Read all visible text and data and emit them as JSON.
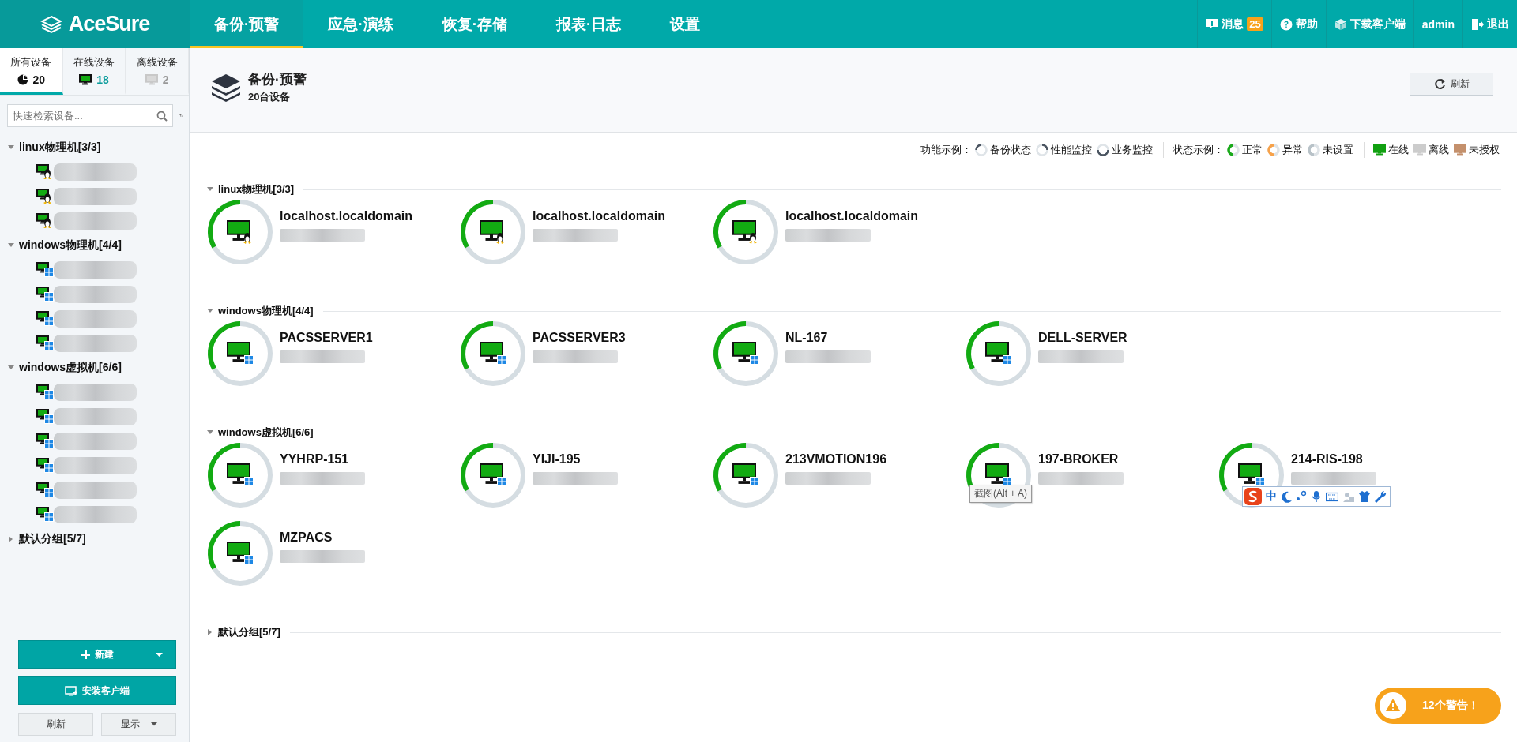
{
  "brand": {
    "name": "AceSure"
  },
  "nav": [
    {
      "label": "备份·预警",
      "selected": true
    },
    {
      "label": "应急·演练",
      "selected": false
    },
    {
      "label": "恢复·存储",
      "selected": false
    },
    {
      "label": "报表·日志",
      "selected": false
    },
    {
      "label": "设置",
      "selected": false
    }
  ],
  "top_links": [
    {
      "kind": "messages",
      "label": "消息",
      "badge": "25"
    },
    {
      "kind": "help",
      "label": "帮助"
    },
    {
      "kind": "download",
      "label": "下载客户端"
    },
    {
      "kind": "user",
      "label": "admin"
    },
    {
      "kind": "logout",
      "label": "退出"
    }
  ],
  "sidebar": {
    "tabs": [
      {
        "kind": "all",
        "label": "所有设备",
        "count": "20",
        "selected": true
      },
      {
        "kind": "online",
        "label": "在线设备",
        "count": "18",
        "selected": false
      },
      {
        "kind": "offline",
        "label": "离线设备",
        "count": "2",
        "selected": false
      }
    ],
    "search": {
      "placeholder": "快速检索设备..."
    },
    "groups": [
      {
        "label": "linux物理机[3/3]",
        "expanded": true,
        "children": [
          {
            "kind": "linux"
          },
          {
            "kind": "linux"
          },
          {
            "kind": "linux"
          }
        ]
      },
      {
        "label": "windows物理机[4/4]",
        "expanded": true,
        "children": [
          {
            "kind": "windows"
          },
          {
            "kind": "windows"
          },
          {
            "kind": "windows"
          },
          {
            "kind": "windows"
          }
        ]
      },
      {
        "label": "windows虚拟机[6/6]",
        "expanded": true,
        "children": [
          {
            "kind": "windows"
          },
          {
            "kind": "windows"
          },
          {
            "kind": "windows"
          },
          {
            "kind": "windows"
          },
          {
            "kind": "windows"
          },
          {
            "kind": "windows"
          }
        ]
      },
      {
        "label": "默认分组[5/7]",
        "expanded": false
      }
    ],
    "new_button": {
      "label": "新建"
    },
    "install_button": {
      "label": "安装客户端"
    },
    "refresh_button": {
      "label": "刷新"
    },
    "display_button": {
      "label": "显示"
    }
  },
  "page_header": {
    "title": "备份·预警",
    "subtitle": "20台设备",
    "refresh_button": "刷新"
  },
  "legend": {
    "function_label": "功能示例：",
    "functions": [
      {
        "kind": "backup",
        "label": "备份状态"
      },
      {
        "kind": "performance",
        "label": "性能监控"
      },
      {
        "kind": "business",
        "label": "业务监控"
      }
    ],
    "status_label": "状态示例：",
    "statuses": [
      {
        "label": "正常",
        "color": "#1aaa1a"
      },
      {
        "label": "异常",
        "color": "#f7a24a"
      },
      {
        "label": "未设置",
        "color": "#b8c2c8"
      }
    ],
    "presence": [
      {
        "label": "在线",
        "color": "#11a011"
      },
      {
        "label": "离线",
        "color": "#cccccc"
      },
      {
        "label": "未授权",
        "color": "#c4906c"
      }
    ]
  },
  "groups": [
    {
      "label": "linux物理机[3/3]",
      "expanded": true,
      "devices": [
        {
          "name": "localhost.localdomain",
          "kind": "linux",
          "color": "#12ab12"
        },
        {
          "name": "localhost.localdomain",
          "kind": "linux",
          "color": "#12ab12"
        },
        {
          "name": "localhost.localdomain",
          "kind": "linux",
          "color": "#12ab12"
        }
      ]
    },
    {
      "label": "windows物理机[4/4]",
      "expanded": true,
      "devices": [
        {
          "name": "PACSSERVER1",
          "kind": "windows",
          "color": "#12ab12"
        },
        {
          "name": "PACSSERVER3",
          "kind": "windows",
          "color": "#12ab12"
        },
        {
          "name": "NL-167",
          "kind": "windows",
          "color": "#12ab12"
        },
        {
          "name": "DELL-SERVER",
          "kind": "windows",
          "color": "#12ab12"
        }
      ]
    },
    {
      "label": "windows虚拟机[6/6]",
      "expanded": true,
      "devices": [
        {
          "name": "YYHRP-151",
          "kind": "windows",
          "color": "#12ab12"
        },
        {
          "name": "YIJI-195",
          "kind": "windows",
          "color": "#12ab12"
        },
        {
          "name": "213VMOTION196",
          "kind": "windows",
          "color": "#12ab12"
        },
        {
          "name": "197-BROKER",
          "kind": "windows",
          "color": "#12ab12"
        },
        {
          "name": "214-RIS-198",
          "kind": "windows",
          "color": "#12ab12"
        },
        {
          "name": "MZPACS",
          "kind": "windows",
          "color": "#12ab12"
        }
      ]
    },
    {
      "label": "默认分组[5/7]",
      "expanded": false
    }
  ],
  "tooltip": {
    "text": "截图(Alt + A)"
  },
  "ime_toolbar": {
    "label": "中"
  },
  "alert": {
    "label": "12个警告！"
  }
}
